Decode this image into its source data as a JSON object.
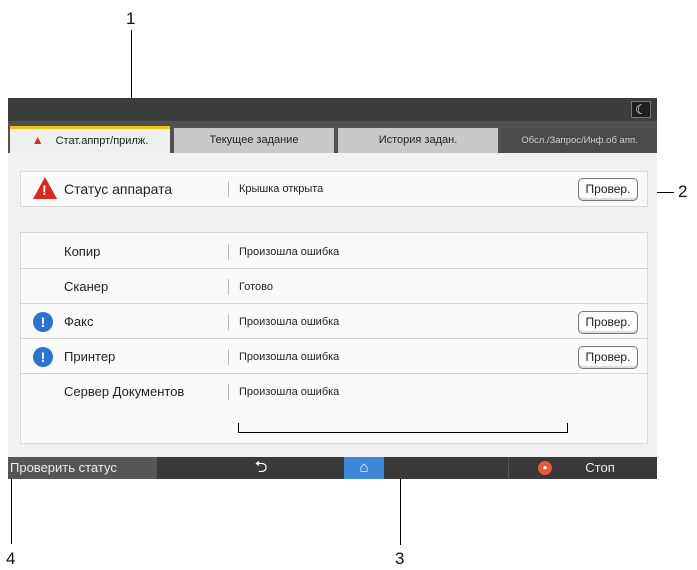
{
  "callouts": {
    "c1": "1",
    "c2": "2",
    "c3": "3",
    "c4": "4"
  },
  "topbar": {
    "moon_glyph": "☾"
  },
  "tabs": [
    {
      "label": "Стат.аппрт/прилж.",
      "active": true,
      "icon": "warning-icon"
    },
    {
      "label": "Текущее задание"
    },
    {
      "label": "История задан."
    },
    {
      "label": "Обсл./Запрос/Инф.об апп."
    }
  ],
  "machine_status": {
    "label": "Статус аппарата",
    "value": "Крышка открыта",
    "button": "Провер.",
    "icon": "warning-icon"
  },
  "functions": [
    {
      "label": "Копир",
      "status": "Произошла ошибка",
      "icon": null,
      "button": null
    },
    {
      "label": "Сканер",
      "status": "Готово",
      "icon": null,
      "button": null
    },
    {
      "label": "Факс",
      "status": "Произошла ошибка",
      "icon": "info-icon",
      "button": "Провер."
    },
    {
      "label": "Принтер",
      "status": "Произошла ошибка",
      "icon": "info-icon",
      "button": "Провер."
    },
    {
      "label": "Сервер Документов",
      "status": "Произошла ошибка",
      "icon": null,
      "button": null
    }
  ],
  "bottombar": {
    "check_status": "Проверить статус",
    "back_glyph": "⮌",
    "home_glyph": "⌂",
    "stop_label": "Стоп"
  },
  "colors": {
    "accent_tab": "#f2c311",
    "warning": "#d82b20",
    "info": "#2a74cf",
    "home": "#3d85d6",
    "stop": "#e75a33"
  }
}
